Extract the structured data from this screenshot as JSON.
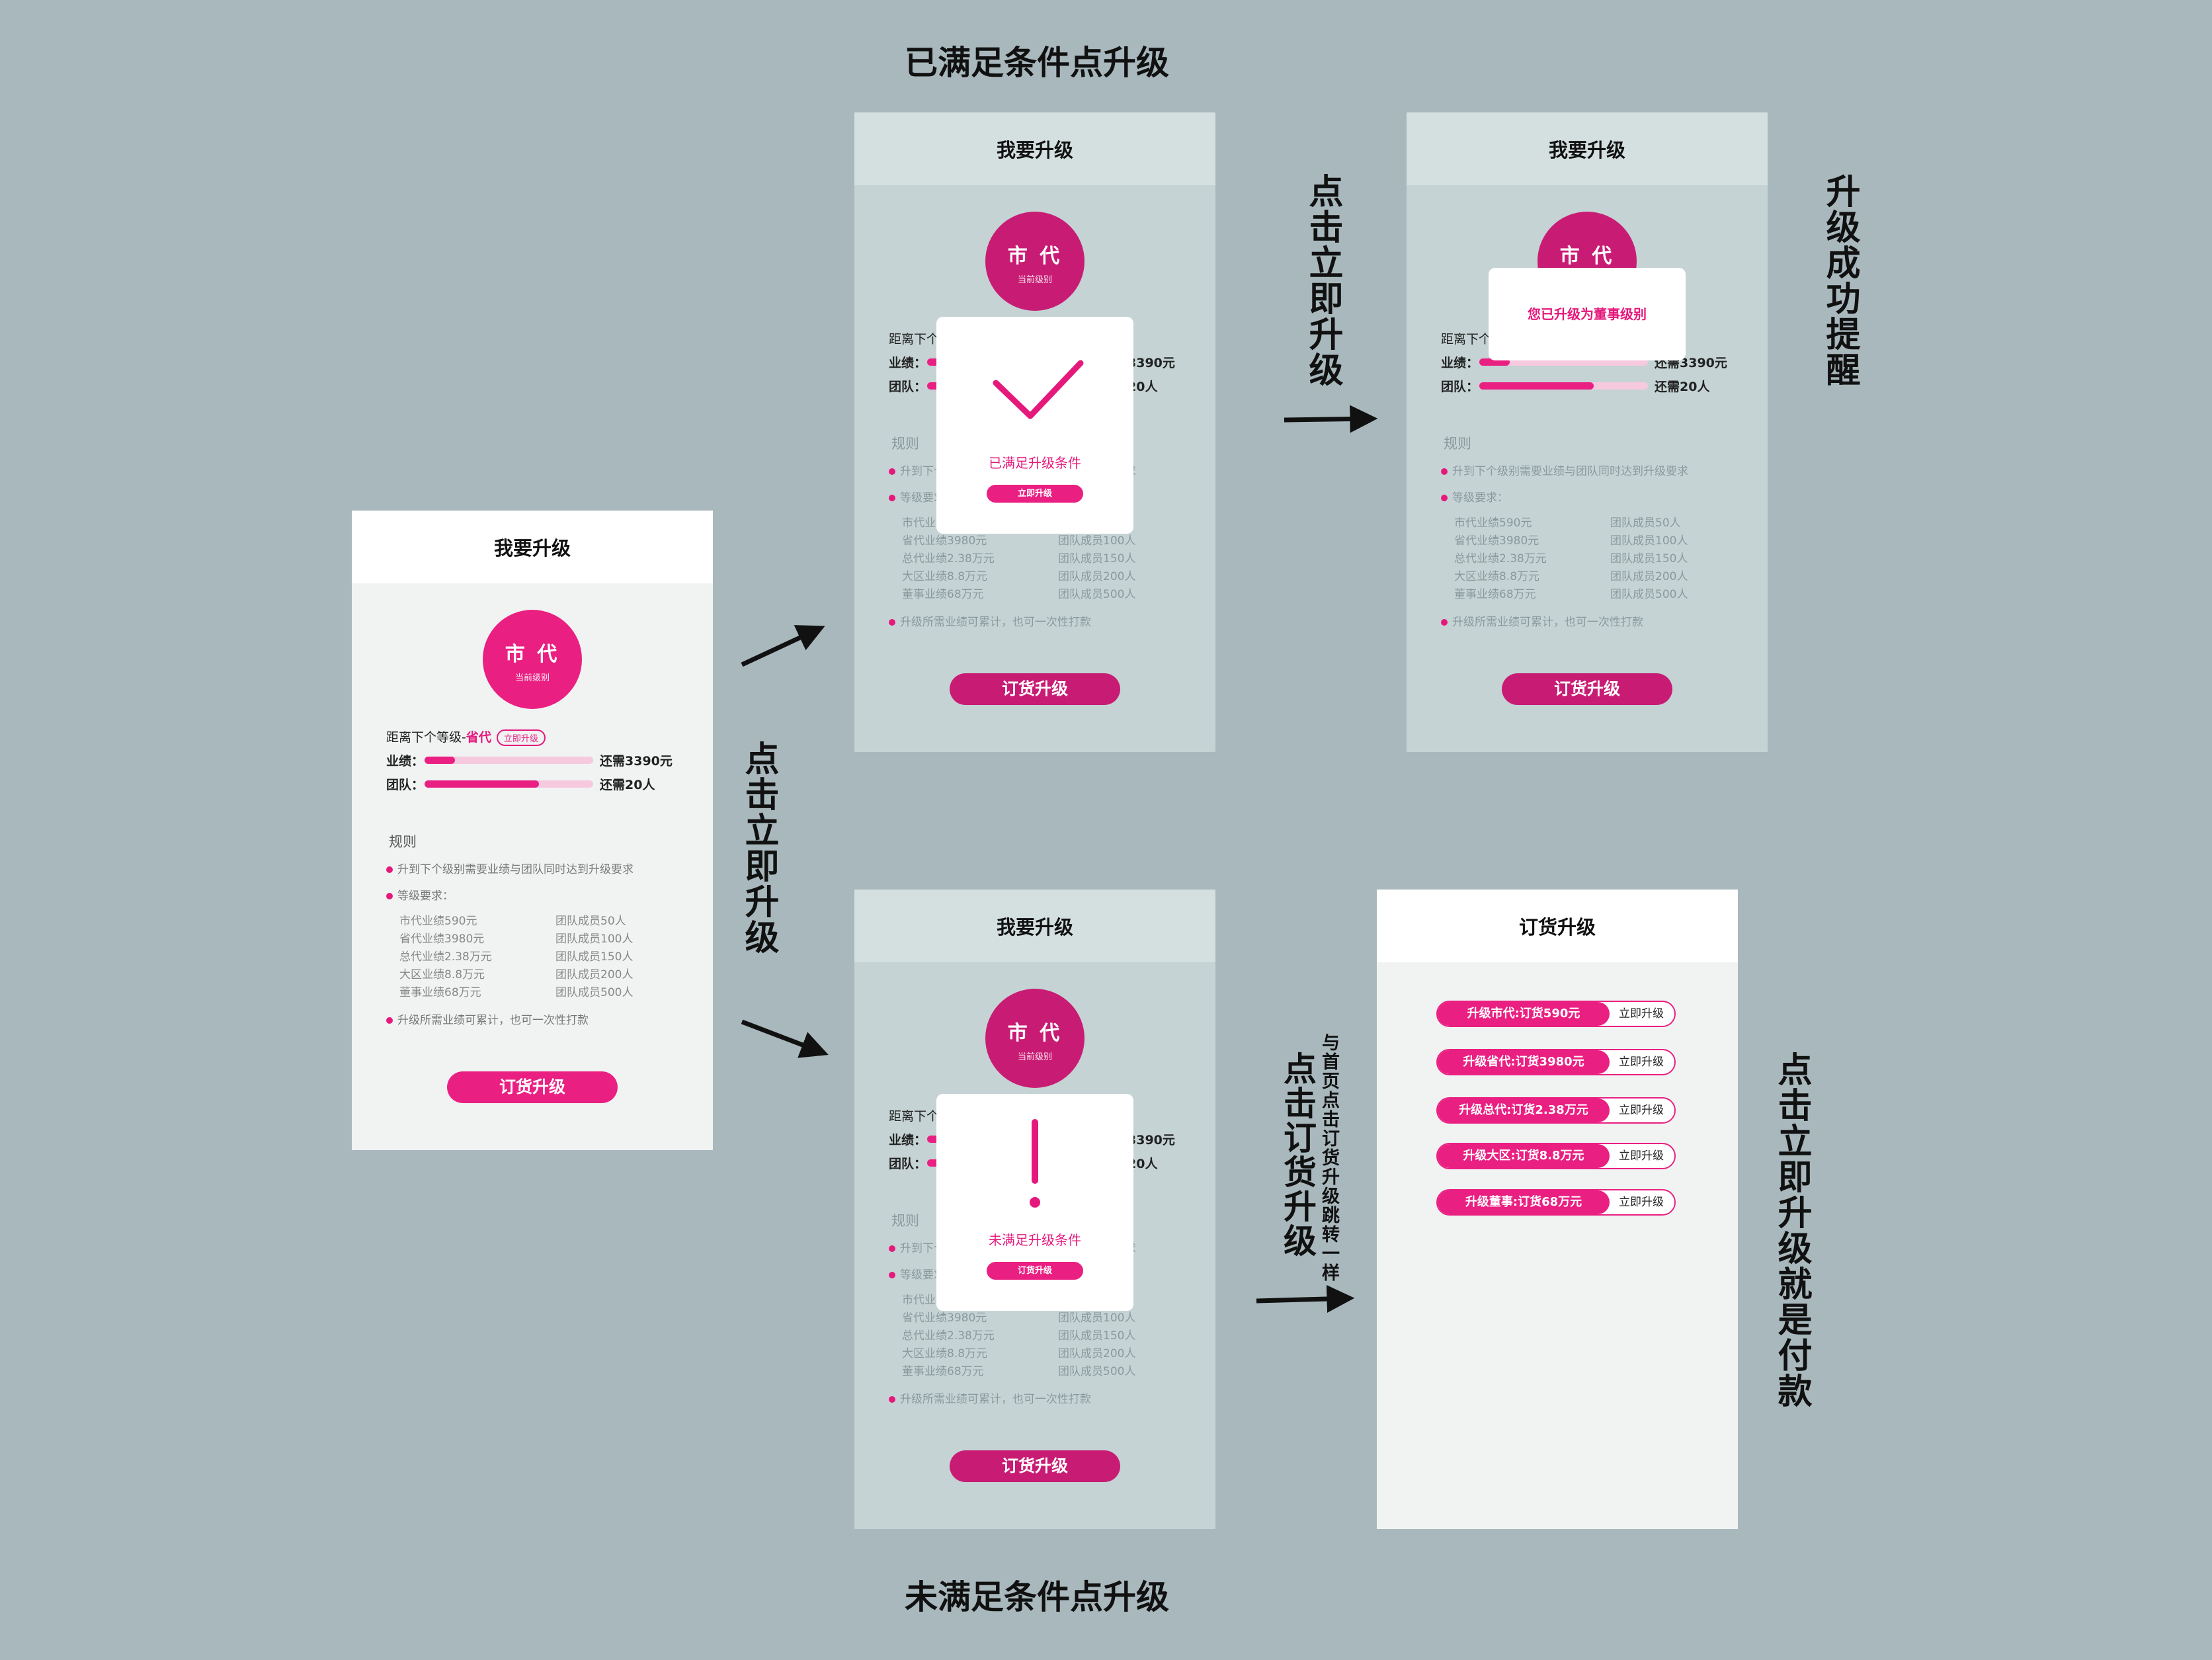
{
  "labels": {
    "top_title": "已满足条件点升级",
    "bottom_title": "未满足条件点升级",
    "click_upgrade": "点击立即升级",
    "click_upgrade_2": "点击立即升级",
    "success_note": "升级成功提醒",
    "click_order": "点击订货升级",
    "same_jump": "与首页点击订货升级跳转一样",
    "pay_note": "点击立即升级就是付款"
  },
  "page": {
    "title": "我要升级",
    "level_name": "市 代",
    "level_sub": "当前级别",
    "next_prefix": "距离下个等级-",
    "next_level": "省代",
    "upgrade_tag": "立即升级",
    "sales_label": "业绩：",
    "sales_need": "还需3390元",
    "sales_progress": 0.18,
    "team_label": "团队：",
    "team_need": "还需20人",
    "team_progress": 0.68,
    "rules_title": "规则",
    "rule_1": "升到下个级别需要业绩与团队同时达到升级要求",
    "rule_2": "等级要求：",
    "requirements": [
      {
        "sales": "市代业绩590元",
        "team": "团队成员50人"
      },
      {
        "sales": "省代业绩3980元",
        "team": "团队成员100人"
      },
      {
        "sales": "总代业绩2.38万元",
        "team": "团队成员150人"
      },
      {
        "sales": "大区业绩8.8万元",
        "team": "团队成员200人"
      },
      {
        "sales": "董事业绩68万元",
        "team": "团队成员500人"
      }
    ],
    "rule_3": "升级所需业绩可累计，也可一次性打款",
    "order_button": "订货升级"
  },
  "modal_ok": {
    "text": "已满足升级条件",
    "button": "立即升级"
  },
  "modal_fail": {
    "text": "未满足升级条件",
    "button": "订货升级"
  },
  "toast": {
    "text": "您已升级为董事级别"
  },
  "order_page": {
    "title": "订货升级",
    "options": [
      {
        "label": "升级市代:订货590元",
        "action": "立即升级"
      },
      {
        "label": "升级省代:订货3980元",
        "action": "立即升级"
      },
      {
        "label": "升级总代:订货2.38万元",
        "action": "立即升级"
      },
      {
        "label": "升级大区:订货8.8万元",
        "action": "立即升级"
      },
      {
        "label": "升级董事:订货68万元",
        "action": "立即升级"
      }
    ]
  },
  "colors": {
    "accent": "#ea1f82",
    "background": "#a8b8bd"
  }
}
